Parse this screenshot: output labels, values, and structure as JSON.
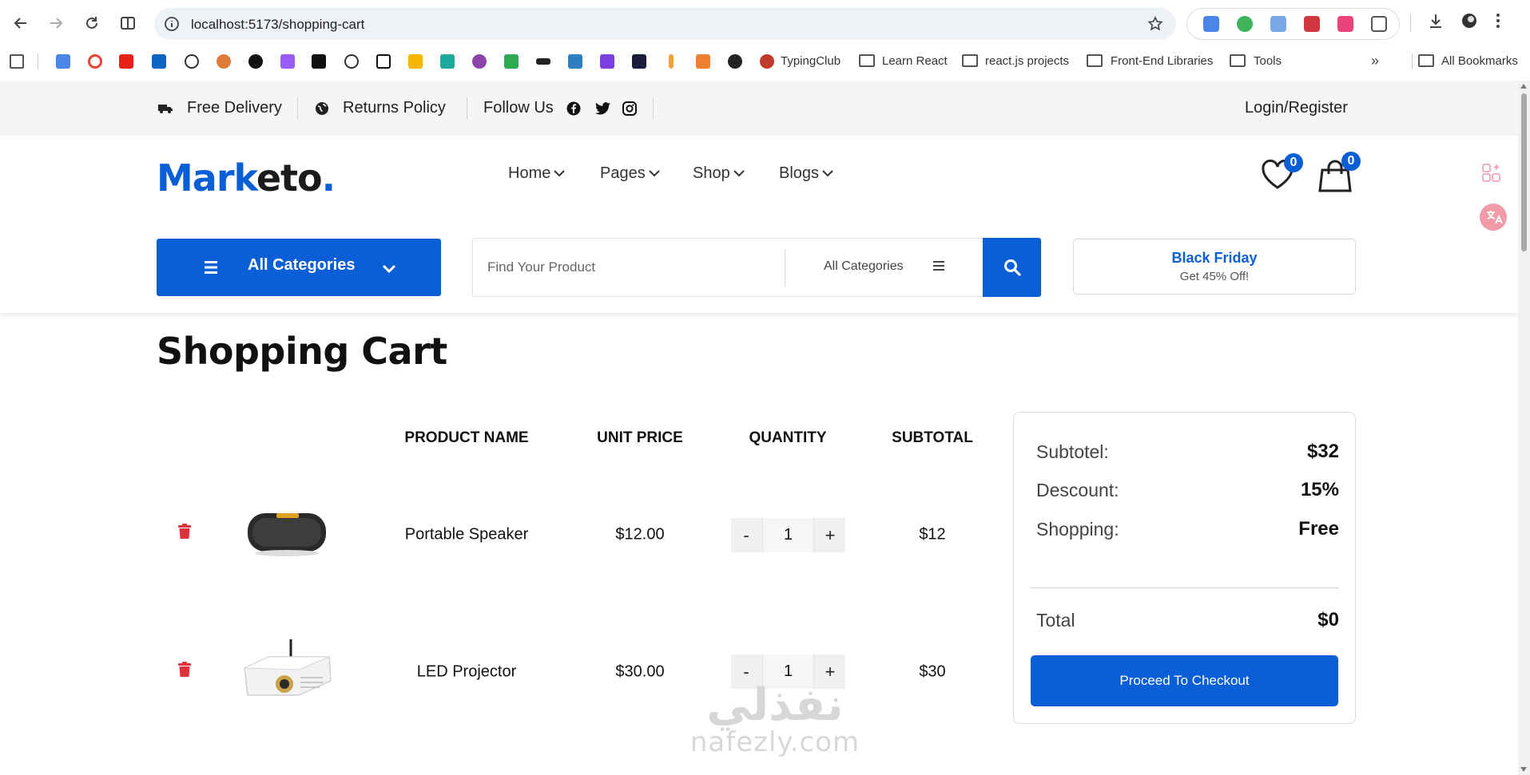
{
  "browser": {
    "url": "localhost:5173/shopping-cart",
    "bookmarks": [
      {
        "label": "TypingClub",
        "type": "site"
      },
      {
        "label": "Learn React",
        "type": "folder"
      },
      {
        "label": "react.js projects",
        "type": "folder"
      },
      {
        "label": "Front-End Libraries",
        "type": "folder"
      },
      {
        "label": "Tools",
        "type": "folder"
      }
    ],
    "all_bookmarks": "All Bookmarks"
  },
  "topbar": {
    "free_delivery": "Free Delivery",
    "returns_policy": "Returns Policy",
    "follow_us": "Follow Us",
    "login_register": "Login/Register"
  },
  "header": {
    "logo_part1": "Mark",
    "logo_part2": "eto",
    "logo_dot": ".",
    "menu": [
      {
        "label": "Home"
      },
      {
        "label": "Pages"
      },
      {
        "label": "Shop"
      },
      {
        "label": "Blogs"
      }
    ],
    "wishlist_count": "0",
    "cart_count": "0",
    "all_categories": "All Categories",
    "search_placeholder": "Find Your Product",
    "search_category": "All Categories",
    "promo_title": "Black Friday",
    "promo_subtitle": "Get 45% Off!"
  },
  "cart": {
    "title": "Shopping Cart",
    "columns": [
      "PRODUCT NAME",
      "UNIT PRICE",
      "QUANTITY",
      "SUBTOTAL"
    ],
    "items": [
      {
        "name": "Portable Speaker",
        "unit_price": "$12.00",
        "quantity": "1",
        "subtotal": "$12",
        "minus": "-",
        "plus": "+"
      },
      {
        "name": "LED Projector",
        "unit_price": "$30.00",
        "quantity": "1",
        "subtotal": "$30",
        "minus": "-",
        "plus": "+"
      }
    ],
    "summary": {
      "subtotal_label": "Subtotel:",
      "subtotal_value": "$32",
      "discount_label": "Descount:",
      "discount_value": "15%",
      "shipping_label": "Shopping:",
      "shipping_value": "Free",
      "total_label": "Total",
      "total_value": "$0",
      "checkout_label": "Proceed To Checkout"
    }
  },
  "watermark": {
    "arabic": "نفذلي",
    "latin": "nafezly.com"
  },
  "colors": {
    "brand": "#0a5fd7",
    "delete": "#e0303a"
  }
}
